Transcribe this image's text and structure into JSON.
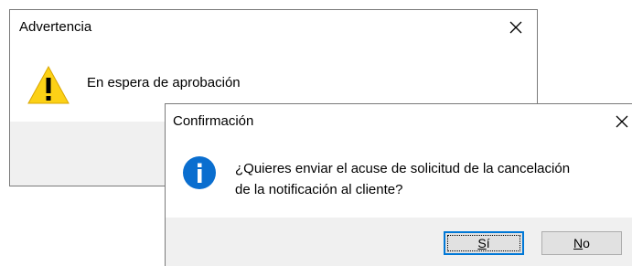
{
  "warning_dialog": {
    "title": "Advertencia",
    "message": "En espera de aprobación",
    "icon": "warning-icon",
    "icon_color": "#fcd116"
  },
  "confirm_dialog": {
    "title": "Confirmación",
    "message_line1": "¿Quieres enviar el acuse de solicitud de la cancelación",
    "message_line2": "de la notificación al cliente?",
    "icon": "info-icon",
    "icon_color": "#0a6ecf",
    "buttons": {
      "yes_mnemonic": "S",
      "yes_rest": "í",
      "no_mnemonic": "N",
      "no_rest": "o"
    }
  },
  "colors": {
    "footer_bg": "#f0f0f0",
    "focus_border": "#0078d7"
  }
}
